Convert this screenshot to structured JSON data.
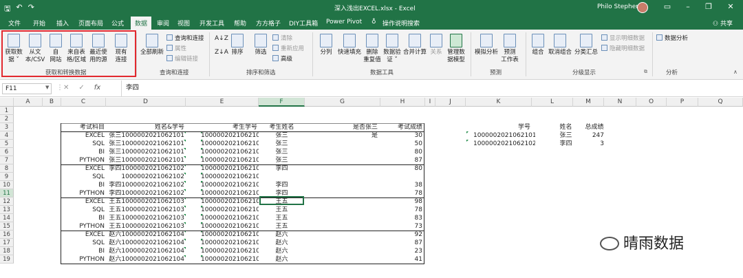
{
  "title_bar": {
    "doc_title": "深入浅出EXCEL.xlsx - Excel",
    "user": "Philo Stephen",
    "save": "🖫",
    "undo": "↶",
    "redo": "↷"
  },
  "tabs": [
    "文件",
    "开始",
    "插入",
    "页面布局",
    "公式",
    "数据",
    "审阅",
    "视图",
    "开发工具",
    "帮助",
    "方方格子",
    "DIY工具箱",
    "Power Pivot",
    "操作说明搜索"
  ],
  "share": "共享",
  "ribbon": {
    "get_data": "获取数\n据 ˅",
    "from_csv": "从文\n本/CSV",
    "from_web": "自\n网站",
    "from_table": "来自表\n格/区域",
    "recent": "最近使\n用的源",
    "existing": "现有\n连接",
    "group1": "获取和转换数据",
    "refresh_all": "全部刷新",
    "queries": "查询和连接",
    "properties": "属性",
    "edit_links": "编辑链接",
    "group2": "查询和连接",
    "sort": "排序",
    "filter": "筛选",
    "clear": "清除",
    "reapply": "重新应用",
    "advanced": "高级",
    "group3": "排序和筛选",
    "text_to_cols": "分列",
    "flash_fill": "快速填充",
    "remove_dup": "删除\n重复值",
    "validation": "数据验\n证 ˅",
    "consolidate": "合并计算",
    "relations": "关系",
    "data_model": "管理数\n据模型",
    "group4": "数据工具",
    "what_if": "模拟分析",
    "forecast": "预测\n工作表",
    "group5": "预测",
    "group_btn": "组合",
    "ungroup": "取消组合",
    "subtotal": "分类汇总",
    "show_detail": "显示明细数据",
    "hide_detail": "隐藏明细数据",
    "group6": "分级显示",
    "data_analysis": "数据分析",
    "group7": "分析"
  },
  "formula_bar": {
    "name_box": "F11",
    "value": "李四",
    "fx": "fx"
  },
  "columns": [
    "A",
    "B",
    "C",
    "D",
    "E",
    "F",
    "G",
    "H",
    "I",
    "J",
    "K",
    "L",
    "M",
    "N",
    "O",
    "P",
    "Q"
  ],
  "rows": [
    "1",
    "2",
    "3",
    "4",
    "5",
    "6",
    "7",
    "8",
    "9",
    "10",
    "11",
    "12",
    "13",
    "14",
    "15",
    "16",
    "17",
    "18",
    "19"
  ],
  "table_headers": {
    "subject": "考试科目",
    "name_id": "姓名&学号",
    "student_id": "考生学号",
    "student_name": "考生姓名",
    "is_zhangsan": "是否张三",
    "score": "考试成绩"
  },
  "table_rows": [
    {
      "subject": "EXCEL",
      "name_id": "张三1000002021062101",
      "student_id": "1000002021062101",
      "name": "张三",
      "flag": "是",
      "score": "30"
    },
    {
      "subject": "SQL",
      "name_id": "张三1000002021062101",
      "student_id": "1000002021062101",
      "name": "张三",
      "flag": "",
      "score": "50"
    },
    {
      "subject": "BI",
      "name_id": "张三1000002021062101",
      "student_id": "1000002021062101",
      "name": "张三",
      "flag": "",
      "score": "80"
    },
    {
      "subject": "PYTHON",
      "name_id": "张三1000002021062101",
      "student_id": "1000002021062101",
      "name": "张三",
      "flag": "",
      "score": "87"
    },
    {
      "subject": "EXCEL",
      "name_id": "李四1000002021062102",
      "student_id": "1000002021062102",
      "name": "李四",
      "flag": "",
      "score": "80"
    },
    {
      "subject": "SQL",
      "name_id": "1000002021062102",
      "student_id": "1000002021062102",
      "name": "",
      "flag": "",
      "score": ""
    },
    {
      "subject": "BI",
      "name_id": "李四1000002021062102",
      "student_id": "1000002021062102",
      "name": "李四",
      "flag": "",
      "score": "38"
    },
    {
      "subject": "PYTHON",
      "name_id": "李四1000002021062102",
      "student_id": "1000002021062102",
      "name": "李四",
      "flag": "",
      "score": "78"
    },
    {
      "subject": "EXCEL",
      "name_id": "王五1000002021062103",
      "student_id": "1000002021062103",
      "name": "王五",
      "flag": "",
      "score": "98"
    },
    {
      "subject": "SQL",
      "name_id": "王五1000002021062103",
      "student_id": "1000002021062103",
      "name": "王五",
      "flag": "",
      "score": "78"
    },
    {
      "subject": "BI",
      "name_id": "王五1000002021062103",
      "student_id": "1000002021062103",
      "name": "王五",
      "flag": "",
      "score": "83"
    },
    {
      "subject": "PYTHON",
      "name_id": "王五1000002021062103",
      "student_id": "1000002021062103",
      "name": "王五",
      "flag": "",
      "score": "73"
    },
    {
      "subject": "EXCEL",
      "name_id": "赵六1000002021062104",
      "student_id": "1000002021062104",
      "name": "赵六",
      "flag": "",
      "score": "92"
    },
    {
      "subject": "SQL",
      "name_id": "赵六1000002021062104",
      "student_id": "1000002021062104",
      "name": "赵六",
      "flag": "",
      "score": "87"
    },
    {
      "subject": "BI",
      "name_id": "赵六1000002021062104",
      "student_id": "1000002021062104",
      "name": "赵六",
      "flag": "",
      "score": "23"
    },
    {
      "subject": "PYTHON",
      "name_id": "赵六1000002021062104",
      "student_id": "1000002021062104",
      "name": "赵六",
      "flag": "",
      "score": "41"
    }
  ],
  "summary": {
    "headers": {
      "id": "学号",
      "name": "姓名",
      "total": "总成绩"
    },
    "rows": [
      {
        "id": "1000002021062101",
        "name": "张三",
        "total": "247"
      },
      {
        "id": "1000002021062102",
        "name": "李四",
        "total": "3"
      }
    ]
  },
  "watermark": "晴雨数据",
  "colors": {
    "excel_green": "#217346",
    "highlight_red": "#e2282e"
  }
}
